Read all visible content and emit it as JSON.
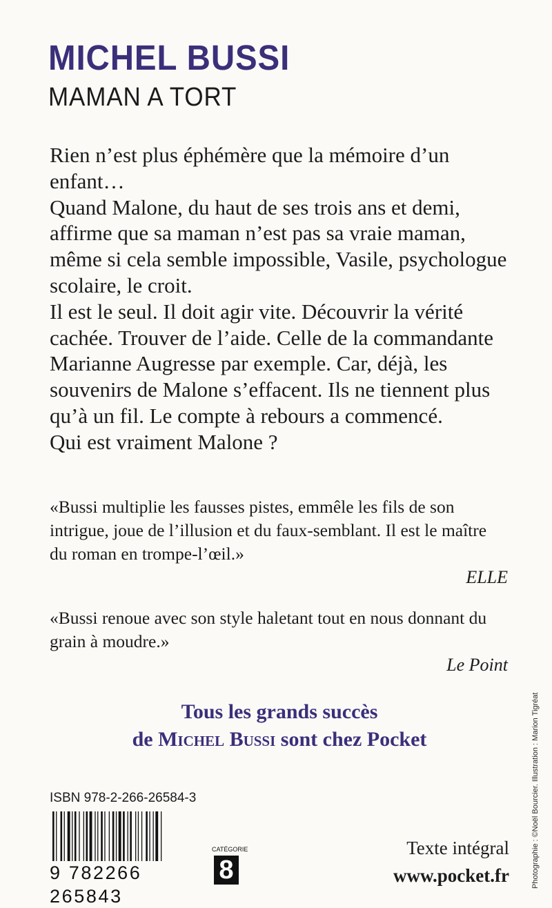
{
  "cover": {
    "author": "MICHEL BUSSI",
    "title": "MAMAN A TORT",
    "blurb": [
      "Rien n’est plus éphémère que la mémoire d’un enfant…",
      "Quand Malone, du haut de ses trois ans et demi, affirme que sa maman n’est pas sa vraie maman, même si cela semble impossible, Vasile, psychologue scolaire, le croit.",
      "Il est le seul. Il doit agir vite. Découvrir la vérité cachée. Trouver de l’aide. Celle de la commandante Marianne Augresse par exemple. Car, déjà, les souvenirs de Malone s’effacent. Ils ne tiennent plus qu’à un fil. Le compte à rebours a commencé.",
      "Qui est vraiment Malone ?"
    ],
    "quotes": [
      {
        "text": "«Bussi multiplie les fausses pistes, emmêle les fils de son intrigue, joue de l’illusion et du faux-semblant. Il est le maître du roman en trompe-l’œil.»",
        "source": "ELLE"
      },
      {
        "text": "«Bussi renoue avec son style haletant tout en nous donnant du grain à moudre.»",
        "source": "Le Point"
      }
    ],
    "promo": {
      "line1": "Tous les grands succès",
      "line2_prefix": "de",
      "line2_name": "Michel Bussi",
      "line2_suffix": "sont chez Pocket"
    },
    "isbn": "ISBN 978-2-266-26584-3",
    "barcode_digits": "9 782266 265843",
    "category_label": "CATÉGORIE",
    "category": "8",
    "edition_note": "Texte intégral",
    "website": "www.pocket.fr",
    "credit": "Photographie : ©Noël Bourcier. Illustration : Marion Tigréat"
  }
}
